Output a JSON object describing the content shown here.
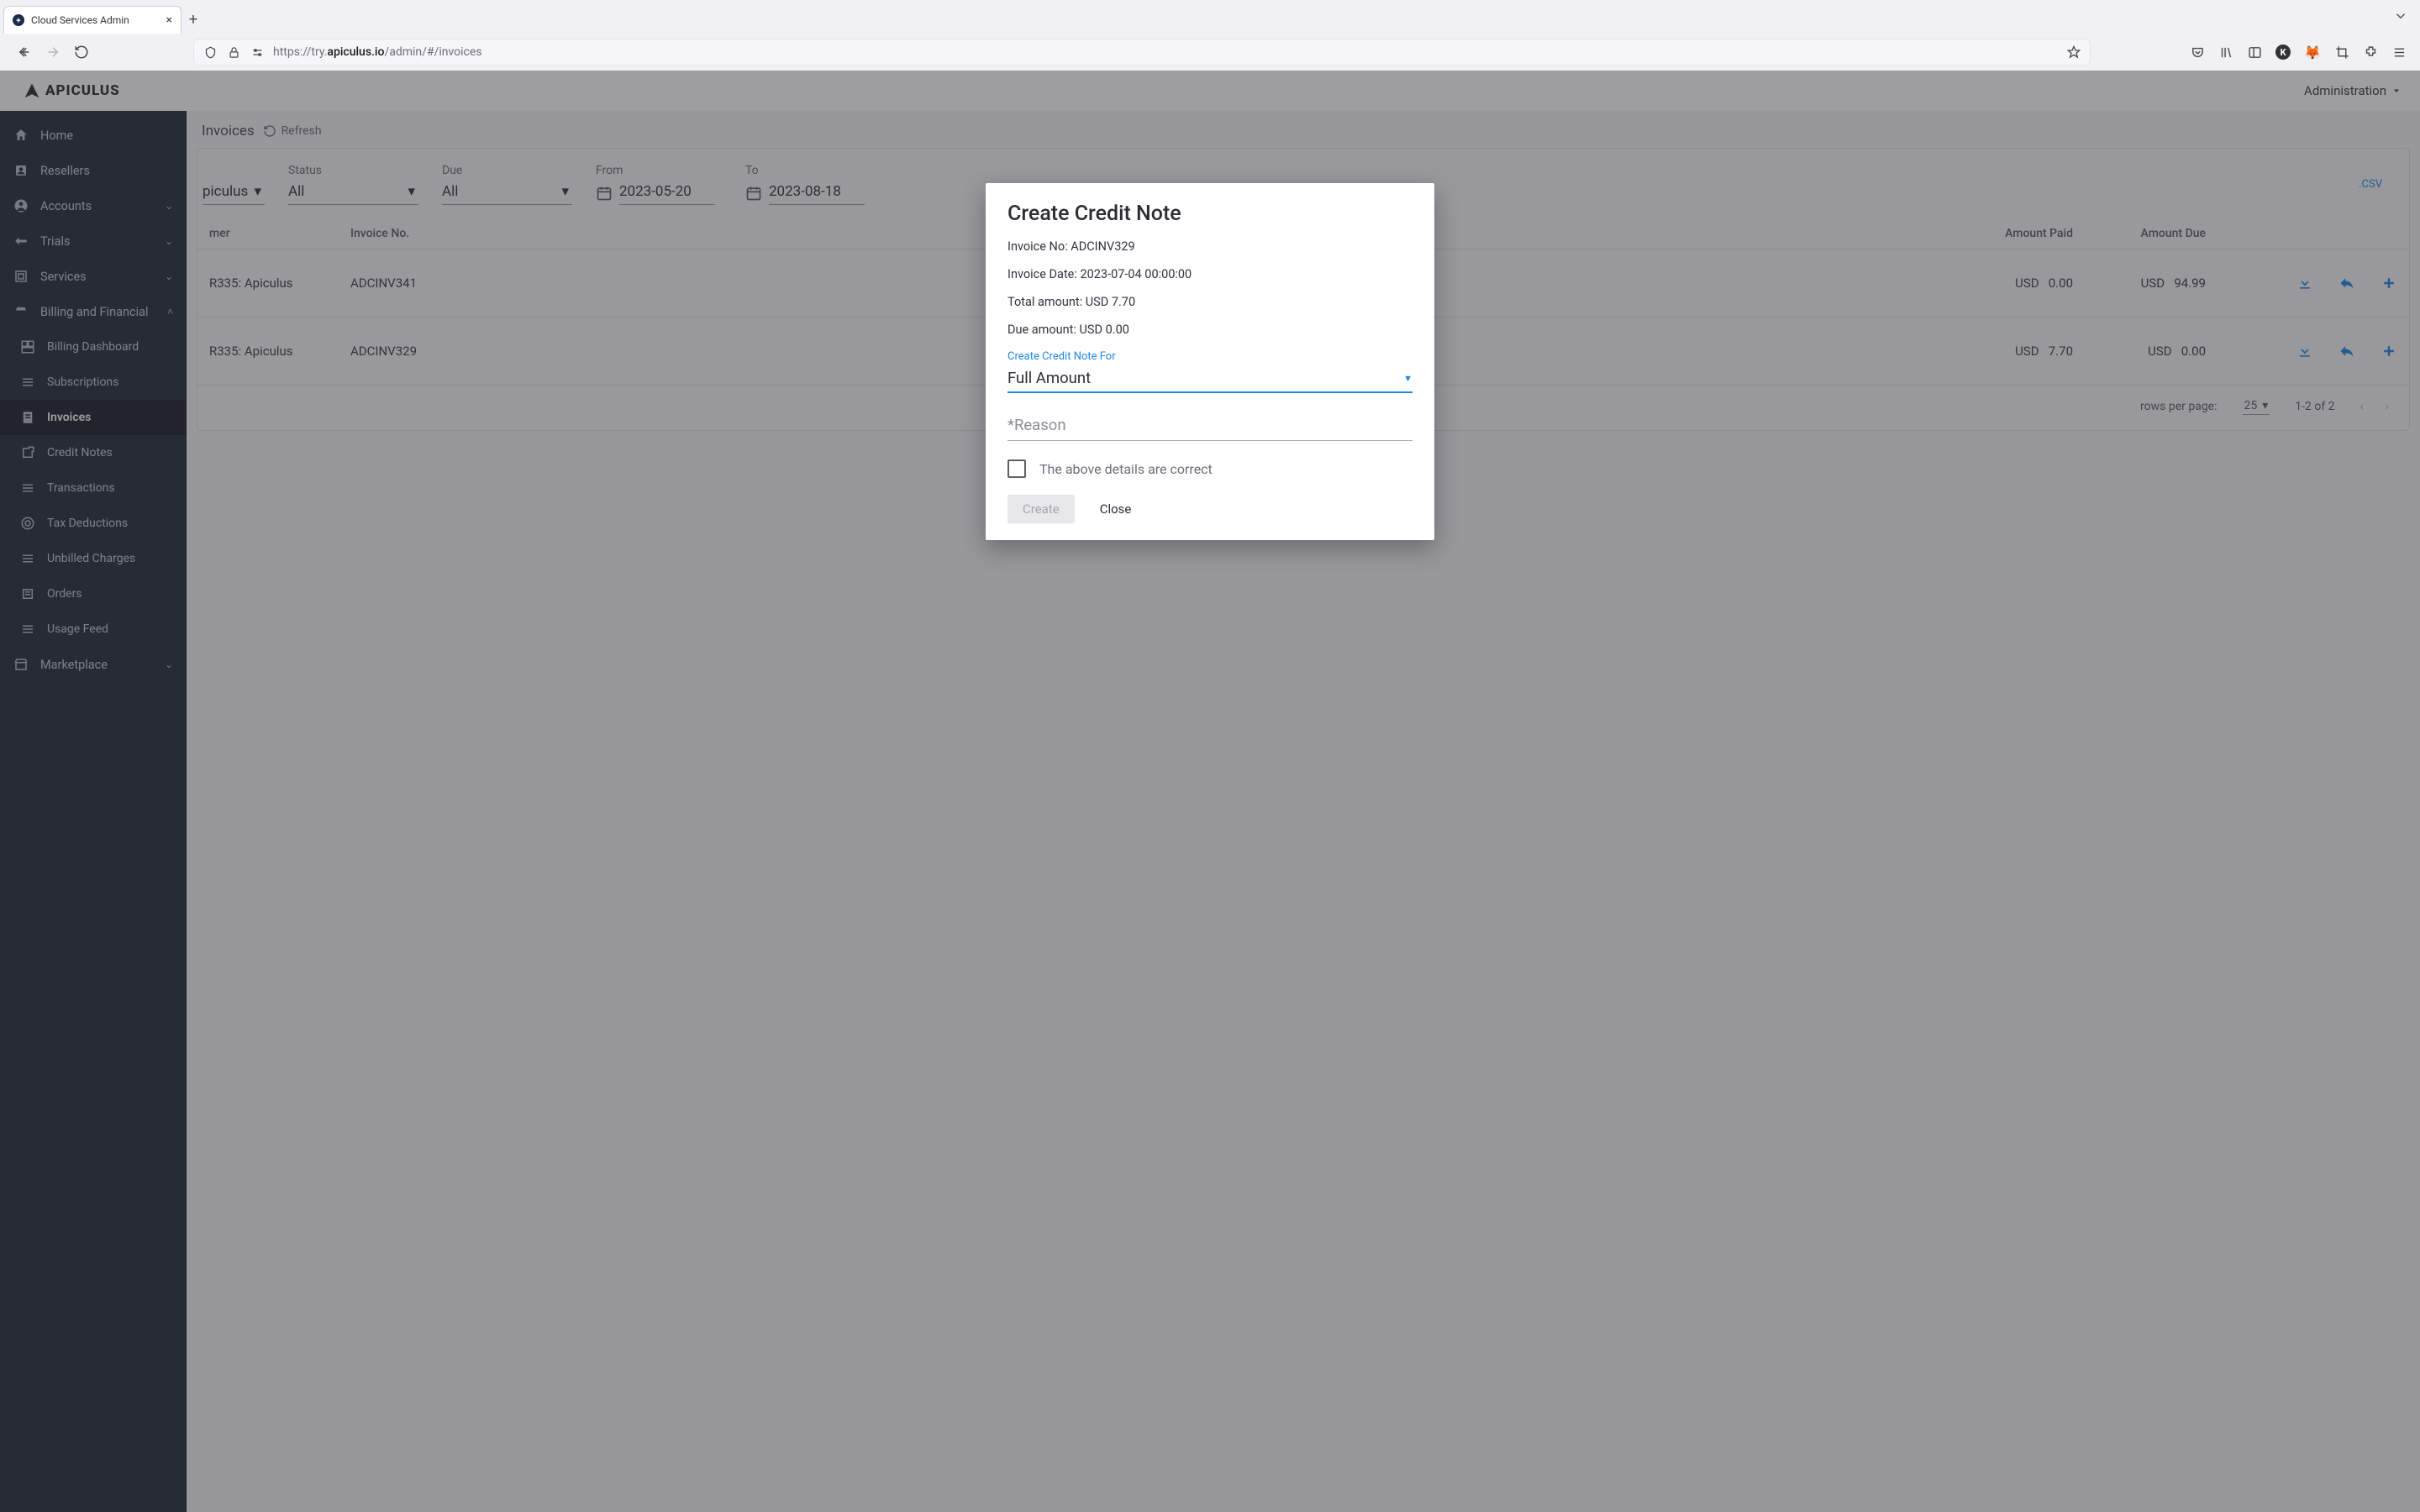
{
  "browser": {
    "tab_title": "Cloud Services Admin",
    "url_scheme": "https://try.",
    "url_host": "apiculus.io",
    "url_path": "/admin/#/invoices"
  },
  "header": {
    "brand": "APICULUS",
    "admin_menu": "Administration"
  },
  "sidebar": {
    "items": [
      {
        "label": "Home",
        "icon": "home"
      },
      {
        "label": "Resellers",
        "icon": "reseller"
      },
      {
        "label": "Accounts",
        "icon": "account",
        "expandable": true
      },
      {
        "label": "Trials",
        "icon": "trial",
        "expandable": true
      },
      {
        "label": "Services",
        "icon": "services",
        "expandable": true
      },
      {
        "label": "Billing and Financial",
        "icon": "billing",
        "expanded": true
      },
      {
        "label": "Billing Dashboard",
        "icon": "dashboard",
        "sub": true
      },
      {
        "label": "Subscriptions",
        "icon": "list",
        "sub": true
      },
      {
        "label": "Invoices",
        "icon": "invoice",
        "sub": true,
        "active": true
      },
      {
        "label": "Credit Notes",
        "icon": "creditnote",
        "sub": true
      },
      {
        "label": "Transactions",
        "icon": "list",
        "sub": true
      },
      {
        "label": "Tax Deductions",
        "icon": "tax",
        "sub": true
      },
      {
        "label": "Unbilled Charges",
        "icon": "list",
        "sub": true
      },
      {
        "label": "Orders",
        "icon": "orders",
        "sub": true
      },
      {
        "label": "Usage Feed",
        "icon": "list",
        "sub": true
      },
      {
        "label": "Marketplace",
        "icon": "marketplace",
        "expandable": true
      }
    ]
  },
  "page": {
    "title": "Invoices",
    "refresh": "Refresh"
  },
  "filters": {
    "customer_value": "piculus",
    "labels": {
      "status": "Status",
      "due": "Due",
      "from": "From",
      "to": "To"
    },
    "status_value": "All",
    "due_value": "All",
    "from_value": "2023-05-20",
    "to_value": "2023-08-18",
    "csv": ".CSV"
  },
  "table": {
    "headers": {
      "customer": "mer",
      "invoice_no": "Invoice No.",
      "amount_paid": "Amount Paid",
      "amount_due": "Amount Due"
    },
    "rows": [
      {
        "customer": "R335: Apiculus",
        "invoice_no": "ADCINV341",
        "paid_ccy": "USD",
        "paid": "0.00",
        "due_ccy": "USD",
        "due": "94.99"
      },
      {
        "customer": "R335: Apiculus",
        "invoice_no": "ADCINV329",
        "paid_ccy": "USD",
        "paid": "7.70",
        "due_ccy": "USD",
        "due": "0.00"
      }
    ],
    "pager": {
      "rows_label": "rows per page:",
      "rows_value": "25",
      "range": "1-2 of 2"
    }
  },
  "modal": {
    "title": "Create Credit Note",
    "invoice_no_label": "Invoice No: ",
    "invoice_no": "ADCINV329",
    "invoice_date_label": "Invoice Date: ",
    "invoice_date": "2023-07-04 00:00:00",
    "total_label": "Total amount: ",
    "total": "USD 7.70",
    "due_label": "Due amount: ",
    "due": "USD 0.00",
    "for_label": "Create Credit Note For",
    "for_value": "Full Amount",
    "reason_placeholder": "*Reason",
    "confirm_label": "The above details are correct",
    "create": "Create",
    "close": "Close"
  }
}
